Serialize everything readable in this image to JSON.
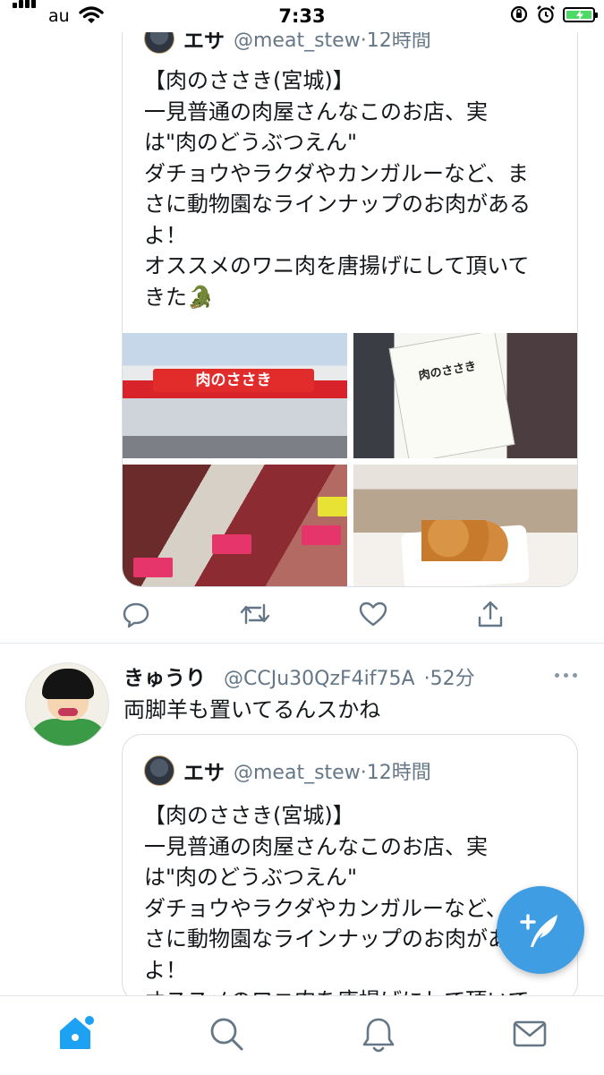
{
  "status_bar": {
    "carrier": "au",
    "time": "7:33"
  },
  "quoted_tweet_1": {
    "name": "エサ",
    "handle": "@meat_stew",
    "time": "·12時間",
    "text": "【肉のささき(宮城)】\n一見普通の肉屋さんなこのお店、実\nは\"肉のどうぶつえん\"\nダチョウやラクダやカンガルーなど、ま\nさに動物園なラインナップのお肉がある\nよ！\nオススメのワニ肉を唐揚げにして頂いて\nきた🐊",
    "photos": {
      "shop_sign": "肉のささき",
      "menu_title": "肉のささき"
    }
  },
  "tweet_2": {
    "name": "きゅうり",
    "handle": "@CCJu30QzF4if75A",
    "time": "·52分",
    "text": "両脚羊も置いてるんスかね"
  },
  "quoted_tweet_2": {
    "name": "エサ",
    "handle": "@meat_stew",
    "time": "·12時間",
    "text": "【肉のささき(宮城)】\n一見普通の肉屋さんなこのお店、実\nは\"肉のどうぶつえん\"\nダチョウやラクダやカンガルーなど、ま\nさに動物園なラインナップのお肉がある\nよ！\nオススメのワニ肉を唐揚げにして頂いて"
  },
  "colors": {
    "accent": "#1da1f2",
    "fab": "#3f9de4",
    "secondary_text": "#657786"
  },
  "icons": {
    "actions": [
      "reply-icon",
      "retweet-icon",
      "like-icon",
      "share-icon"
    ],
    "tabs": [
      "home-icon",
      "search-icon",
      "notifications-icon",
      "messages-icon"
    ],
    "fab": "compose-tweet-icon"
  }
}
